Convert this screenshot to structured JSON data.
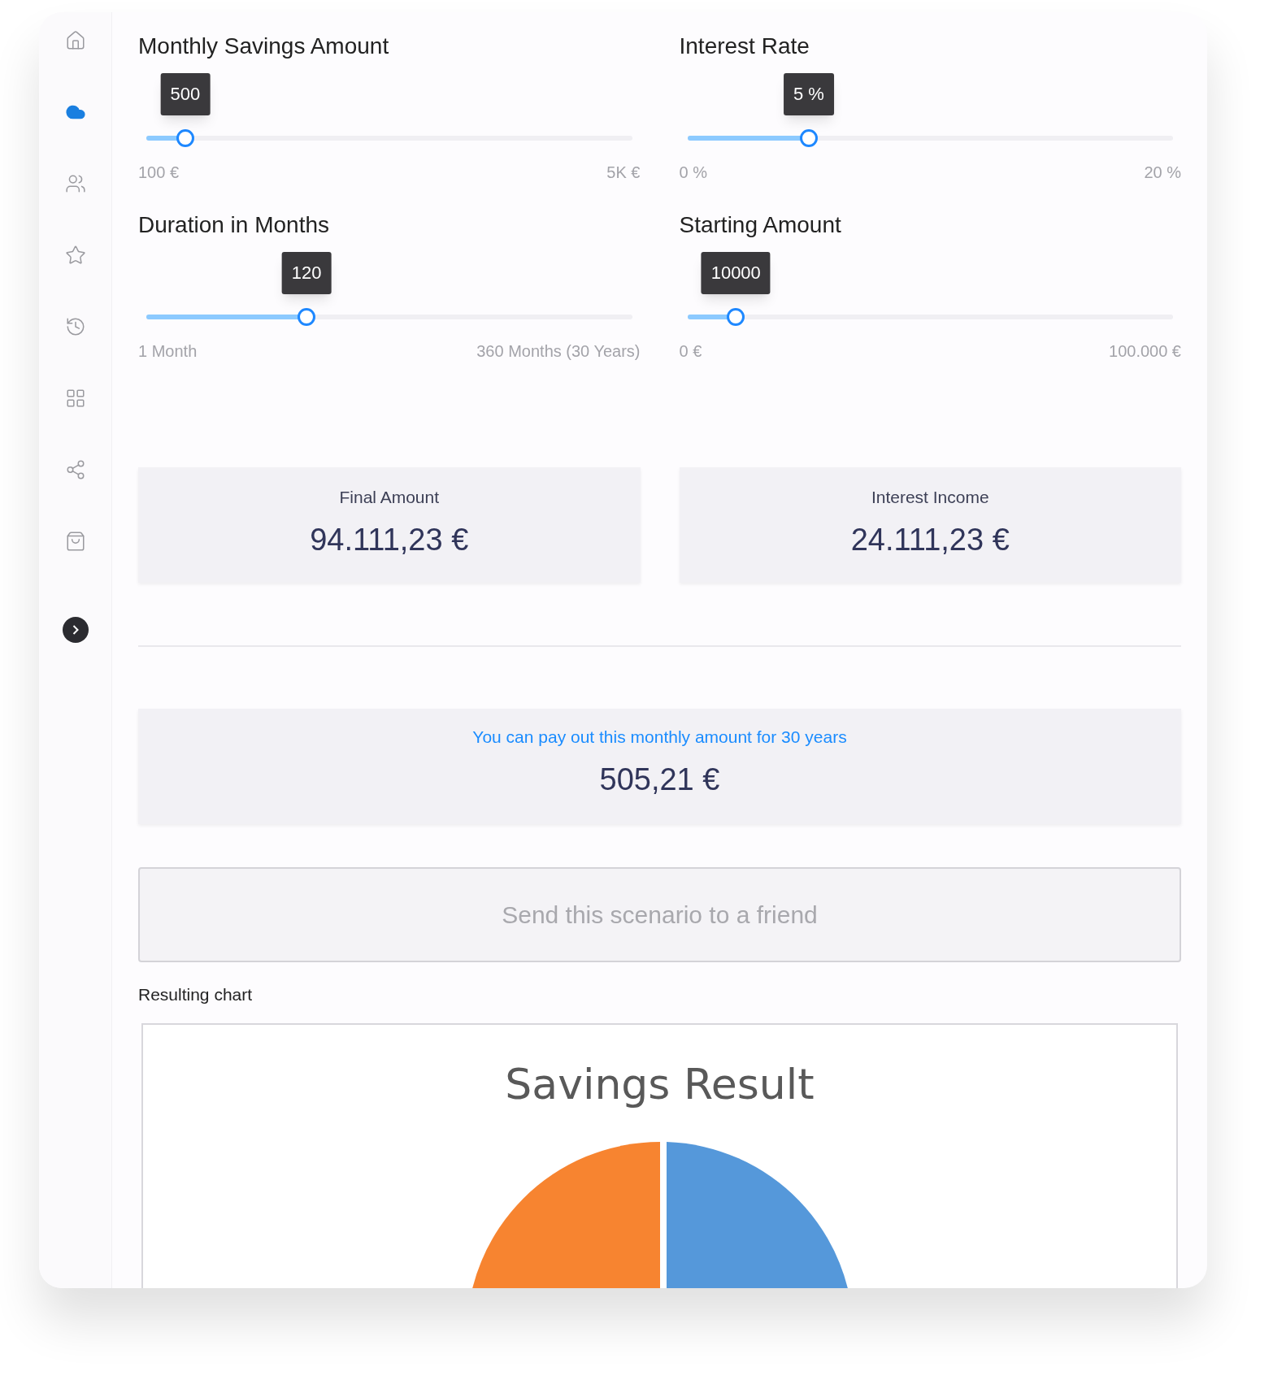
{
  "sidebar": {
    "items": [
      {
        "selected": false
      },
      {
        "selected": true
      },
      {
        "selected": false
      },
      {
        "selected": false
      },
      {
        "selected": false
      },
      {
        "selected": false
      },
      {
        "selected": false
      },
      {
        "selected": false
      }
    ]
  },
  "sliders": [
    {
      "title": "Monthly Savings Amount",
      "value": "500",
      "level": 0.08,
      "min": "100 €",
      "max": "5K €"
    },
    {
      "title": "Interest Rate",
      "value": "5 %",
      "level": 0.25,
      "min": "0 %",
      "max": "20 %"
    },
    {
      "title": "Duration in Months",
      "value": "120",
      "level": 0.33,
      "min": "1 Month",
      "max": "360 Months (30 Years)"
    },
    {
      "title": "Starting Amount",
      "value": "10000",
      "level": 0.1,
      "min": "0 €",
      "max": "100.000 €"
    }
  ],
  "results": [
    {
      "label": "Final Amount",
      "value": "94.111,23 €"
    },
    {
      "label": "Interest Income",
      "value": "24.111,23 €"
    }
  ],
  "payout": {
    "label": "You can pay out this monthly amount for 30 years",
    "value": "505,21 €"
  },
  "send_button": "Send this scenario to a friend",
  "chart_section": {
    "heading": "Resulting chart",
    "title": "Savings Result"
  }
}
